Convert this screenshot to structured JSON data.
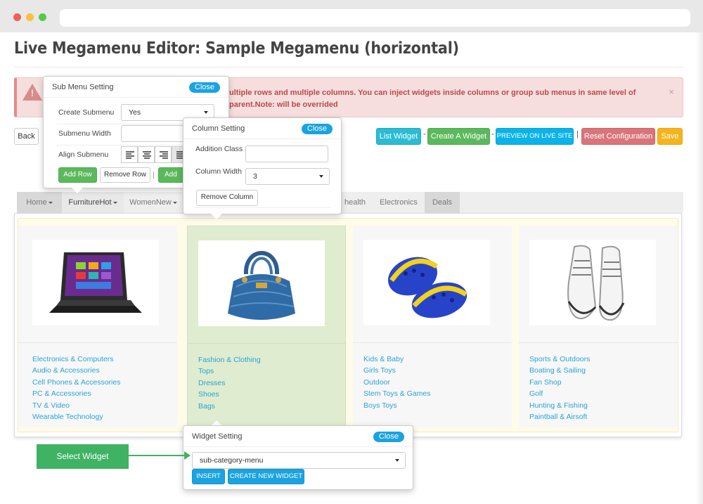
{
  "page": {
    "title": "Live Megamenu Editor: Sample Megamenu (horizontal)"
  },
  "alert": {
    "text": "ultiple rows and multiple columns. You can inject widgets inside columns or group sub menus in same level of parent.Note: will be overrided",
    "close": "×"
  },
  "toolbar": {
    "back": "Back",
    "list_widget": "List Widget",
    "create_widget": "Create A Widget",
    "preview": "PREVIEW ON LIVE SITE",
    "reset": "Reset Configuration",
    "save": "Save",
    "sep": "-",
    "bar": "|"
  },
  "nav": {
    "items": [
      {
        "label": "Home"
      },
      {
        "label": "FurnitureHot"
      },
      {
        "label": "WomenNew"
      },
      {
        "label": "health"
      },
      {
        "label": "Electronics"
      },
      {
        "label": "Deals"
      }
    ]
  },
  "columns": [
    {
      "image": "tablet",
      "links": [
        "Electronics & Computers",
        "Audio & Accessories",
        "Cell Phones & Accessories",
        "PC & Accessories",
        "TV & Video",
        "Wearable Technology"
      ]
    },
    {
      "image": "handbag",
      "links": [
        "Fashion & Clothing",
        "Tops",
        "Dresses",
        "Shoes",
        "Bags"
      ]
    },
    {
      "image": "clogs",
      "links": [
        "Kids & Baby",
        "Girls Toys",
        "Outdoor",
        "Stem Toys & Games",
        "Boys Toys"
      ]
    },
    {
      "image": "sneakers",
      "links": [
        "Sports & Outdoors",
        "Boating & Sailing",
        "Fan Shop",
        "Golf",
        "Hunting & Fishing",
        "Paintball & Airsoft"
      ]
    }
  ],
  "submenu_setting": {
    "title": "Sub Menu Setting",
    "close": "Close",
    "create_label": "Create Submenu",
    "create_value": "Yes",
    "width_label": "Submenu Width",
    "width_value": "",
    "align_label": "Align Submenu",
    "add_row": "Add Row",
    "remove_row": "Remove Row",
    "add_col": "Add Co"
  },
  "column_setting": {
    "title": "Column Setting",
    "close": "Close",
    "class_label": "Addition Class",
    "class_value": "",
    "width_label": "Column Width",
    "width_value": "3",
    "remove": "Remove Column"
  },
  "widget_setting": {
    "title": "Widget Setting",
    "close": "Close",
    "selected": "sub-category-menu",
    "insert": "INSERT",
    "create_new": "CREATE NEW WIDGET"
  },
  "callout": {
    "label": "Select Widget"
  },
  "colors": {
    "accent": "#1aa3e0",
    "green": "#5cb85c",
    "danger": "#d9757a",
    "warning": "#f5b31e",
    "active_column": "#dfeccf"
  }
}
